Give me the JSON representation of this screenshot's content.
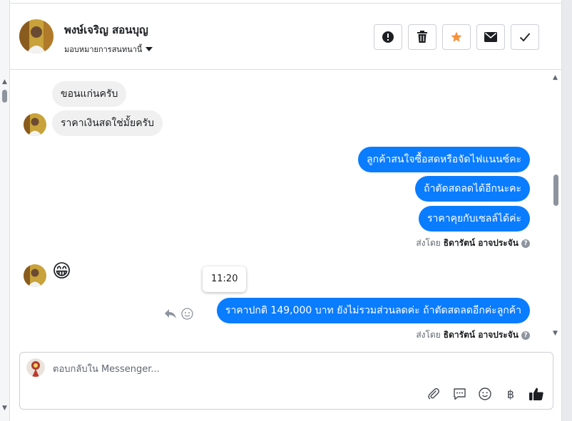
{
  "header": {
    "contact_name": "พงษ์เจริญ สอนบุญ",
    "assign_label": "มอบหมายการสนทนานี้",
    "buttons": [
      {
        "icon": "alert-icon"
      },
      {
        "icon": "trash-icon"
      },
      {
        "icon": "star-icon",
        "color": "#f7923b"
      },
      {
        "icon": "envelope-icon"
      },
      {
        "icon": "check-icon"
      }
    ]
  },
  "messages": {
    "incoming_1": "ขอนแก่นครับ",
    "incoming_2": "ราคาเงินสดใช่มั้ยครับ",
    "outgoing_1": "ลูกค้าสนใจซื้อสดหรือจัดไฟแนนซ์คะ",
    "outgoing_2": "ถ้าตัดสดลดได้อีกนะคะ",
    "outgoing_3": "ราคาคุยกับเซลล์ได้ค่ะ",
    "sent_by_prefix_1": "ส่งโดย",
    "sent_by_name_1": "ธิดารัตน์ อาจประจัน",
    "emoji": "😁",
    "tooltip_time": "11:20",
    "outgoing_4": "ราคาปกติ 149,000 บาท ยังไม่รวมส่วนลดค่ะ ถ้าตัดสดลดอีกค่ะลูกค้า",
    "sent_by_prefix_2": "ส่งโดย",
    "sent_by_name_2": "ธิดารัตน์ อาจประจัน"
  },
  "composer": {
    "placeholder": "ตอบกลับใน Messenger...",
    "value": "",
    "currency_symbol": "฿"
  },
  "colors": {
    "outgoing_bubble": "#0a7cff",
    "incoming_bubble": "#f0f0f0",
    "star": "#f7923b"
  }
}
